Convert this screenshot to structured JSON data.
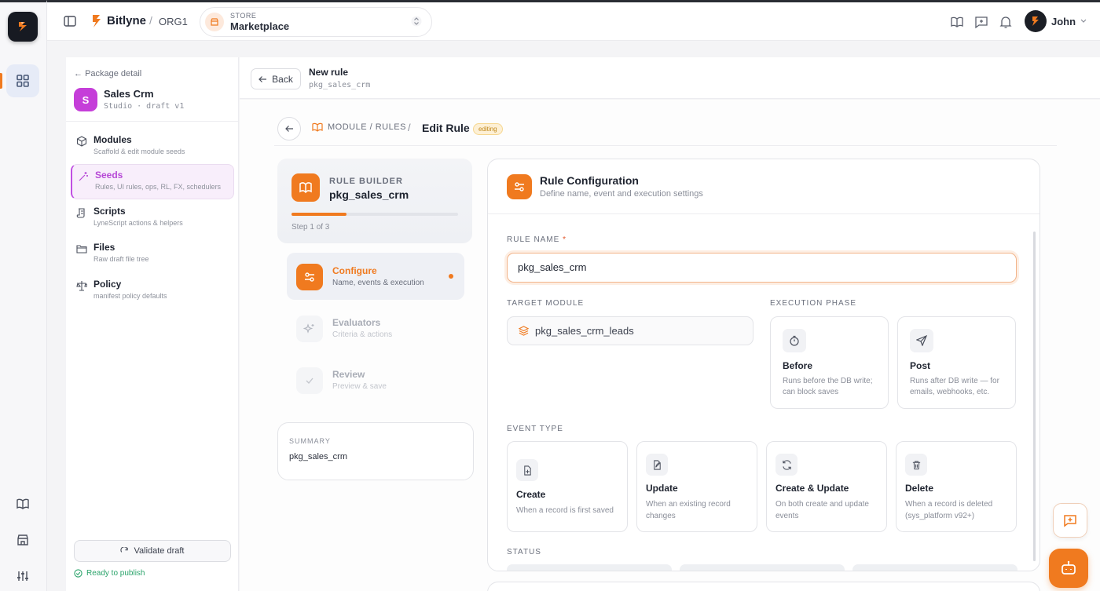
{
  "app": {
    "brand": "Bitlyne",
    "org": "ORG1",
    "user": "John"
  },
  "store": {
    "label": "STORE",
    "value": "Marketplace"
  },
  "package": {
    "back_label": "Package detail",
    "initial": "S",
    "name": "Sales Crm",
    "sub": "Studio · draft v1"
  },
  "sidebar": {
    "items": [
      {
        "label": "Modules",
        "desc": "Scaffold & edit module seeds",
        "icon": "cube-icon"
      },
      {
        "label": "Seeds",
        "desc": "Rules, UI rules, ops, RL, FX, schedulers",
        "icon": "sparkle-wand-icon"
      },
      {
        "label": "Scripts",
        "desc": "LyneScript actions & helpers",
        "icon": "script-icon"
      },
      {
        "label": "Files",
        "desc": "Raw draft file tree",
        "icon": "folder-icon"
      },
      {
        "label": "Policy",
        "desc": "manifest policy defaults",
        "icon": "policy-icon"
      }
    ],
    "validate_label": "Validate draft",
    "ready_label": "Ready to publish"
  },
  "header": {
    "back_label": "Back",
    "title": "New rule",
    "subtitle": "pkg_sales_crm"
  },
  "breadcrumb": {
    "section": "MODULE / RULES",
    "current": "Edit Rule",
    "badge": "editing"
  },
  "builder": {
    "label": "RULE BUILDER",
    "name": "pkg_sales_crm",
    "step_text": "Step 1 of 3",
    "progress": 0.33,
    "steps": [
      {
        "title": "Configure",
        "desc": "Name, events & execution"
      },
      {
        "title": "Evaluators",
        "desc": "Criteria & actions"
      },
      {
        "title": "Review",
        "desc": "Preview & save"
      }
    ]
  },
  "summary": {
    "label": "SUMMARY",
    "value": "pkg_sales_crm"
  },
  "config": {
    "title": "Rule Configuration",
    "subtitle": "Define name, event and execution settings",
    "rule_name_label": "RULE NAME",
    "rule_name_required": "*",
    "rule_name_value": "pkg_sales_crm",
    "target_module_label": "TARGET MODULE",
    "target_module_value": "pkg_sales_crm_leads",
    "execution_phase_label": "EXECUTION PHASE",
    "phases": [
      {
        "title": "Before",
        "desc": "Runs before the DB write; can block saves"
      },
      {
        "title": "Post",
        "desc": "Runs after DB write — for emails, webhooks, etc."
      }
    ],
    "event_type_label": "EVENT TYPE",
    "events": [
      {
        "title": "Create",
        "desc": "When a record is first saved"
      },
      {
        "title": "Update",
        "desc": "When an existing record changes"
      },
      {
        "title": "Create & Update",
        "desc": "On both create and update events"
      },
      {
        "title": "Delete",
        "desc": "When a record is deleted (sys_platform v92+)"
      }
    ],
    "status_label": "STATUS"
  },
  "colors": {
    "accent": "#f07a1f",
    "seeds_active": "#b648d6",
    "ready": "#2aa36a"
  }
}
